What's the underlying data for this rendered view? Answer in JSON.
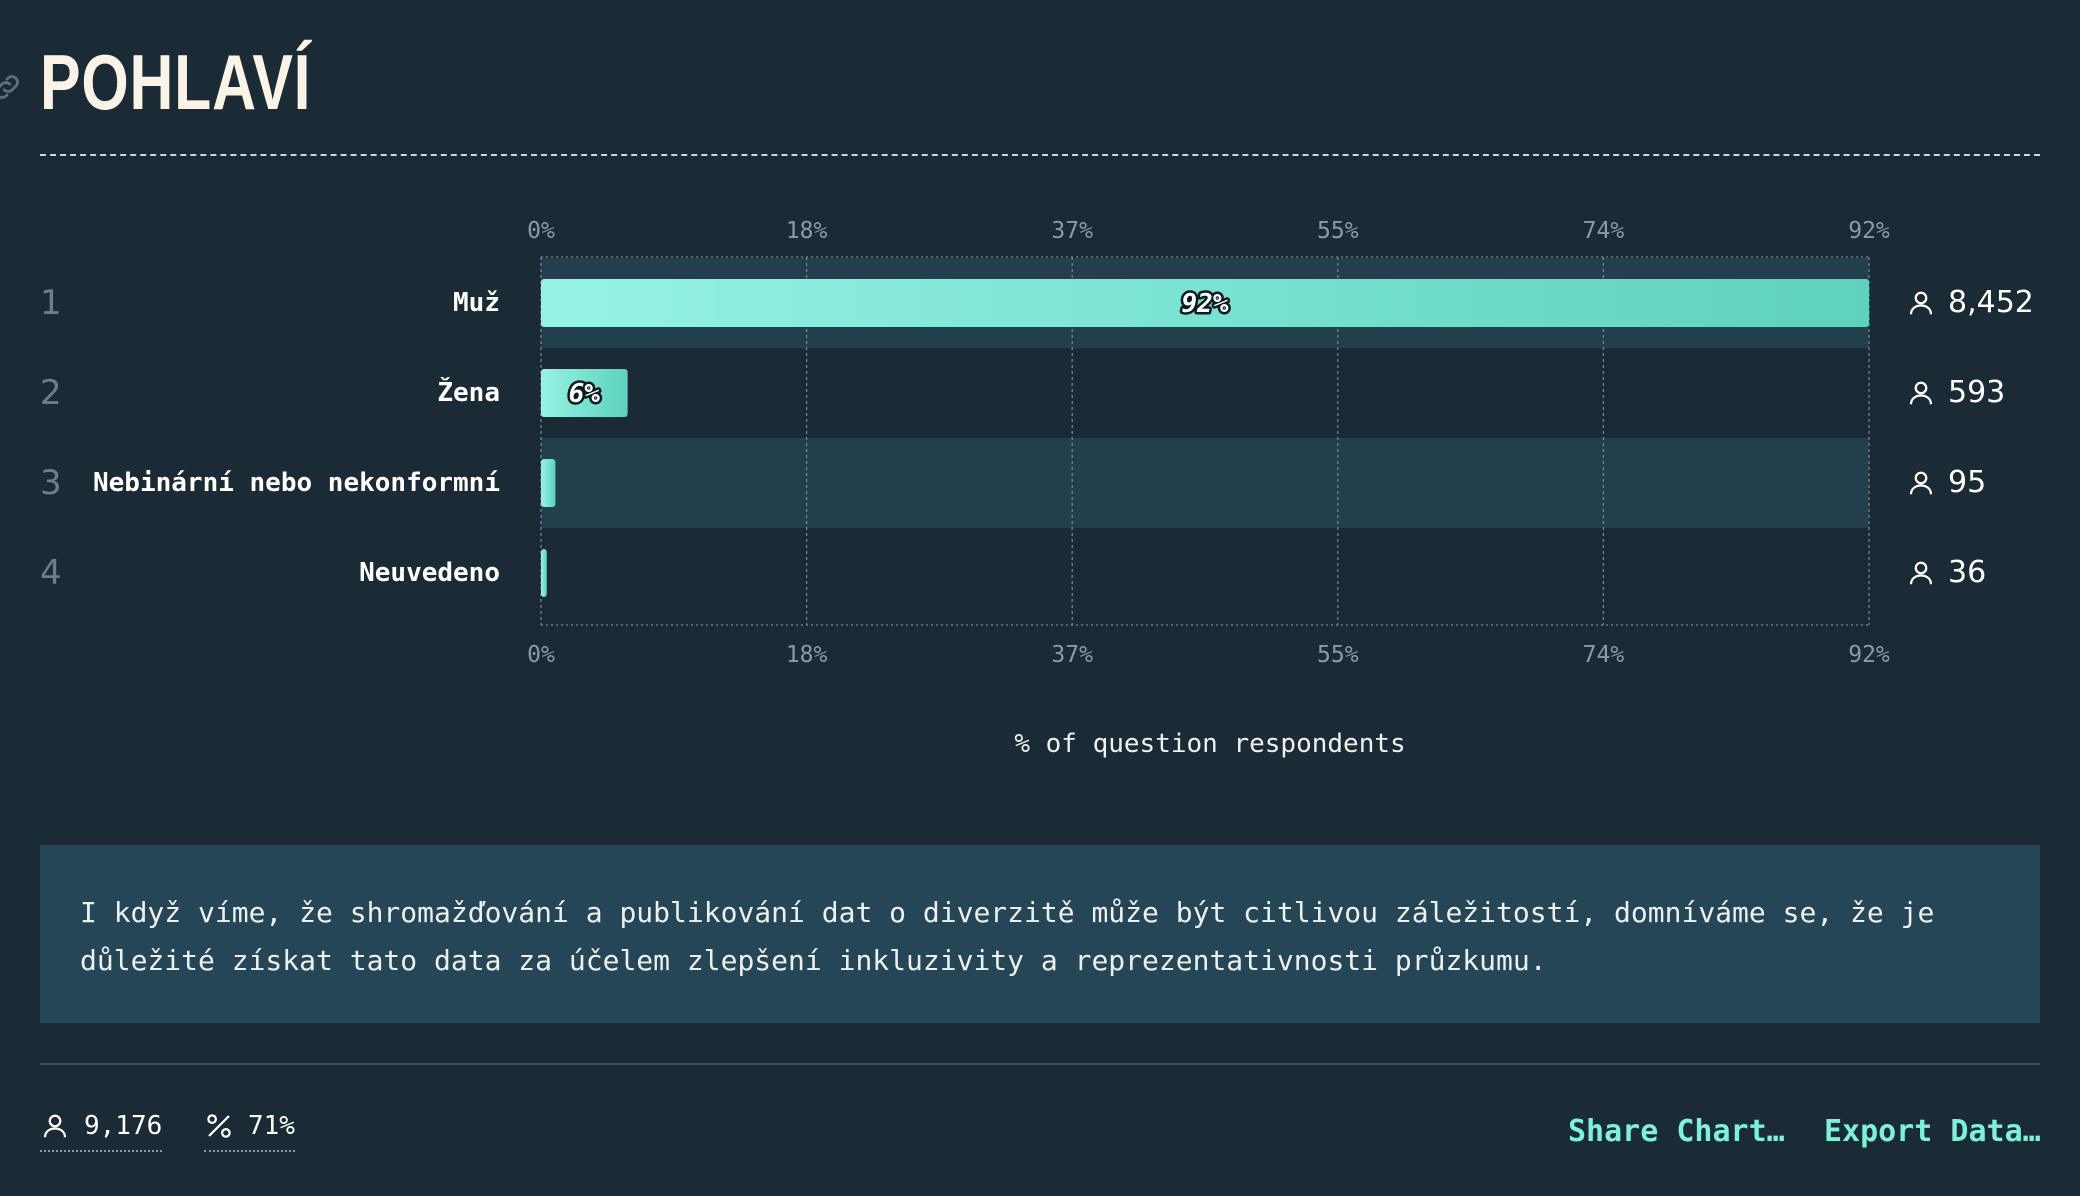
{
  "title": "POHLAVÍ",
  "colors": {
    "background": "#1a2b36",
    "bar_start": "#96f3e3",
    "bar_end": "#5ed1bf",
    "accent": "#7ff0dc",
    "note_bg": "#244657"
  },
  "chart_data": {
    "type": "bar",
    "orientation": "horizontal",
    "categories": [
      "Muž",
      "Žena",
      "Nebinární nebo nekonformní",
      "Neuvedeno"
    ],
    "values": [
      92,
      6,
      1,
      0.4
    ],
    "value_labels": [
      "92%",
      "6%",
      "",
      ""
    ],
    "counts": [
      "8,452",
      "593",
      "95",
      "36"
    ],
    "row_numbers": [
      "1",
      "2",
      "3",
      "4"
    ],
    "xlim": [
      0,
      92
    ],
    "x_ticks": [
      "0%",
      "18%",
      "37%",
      "55%",
      "74%",
      "92%"
    ],
    "xlabel": "% of question respondents",
    "grid": true
  },
  "note": "I když víme, že shromažďování a publikování dat o diverzitě může být citlivou záležitostí, domníváme se, že je důležité získat tato data za účelem zlepšení inkluzivity a reprezentativnosti průzkumu.",
  "footer": {
    "respondents": "9,176",
    "percent": "71%",
    "share_label": "Share Chart…",
    "export_label": "Export Data…"
  }
}
